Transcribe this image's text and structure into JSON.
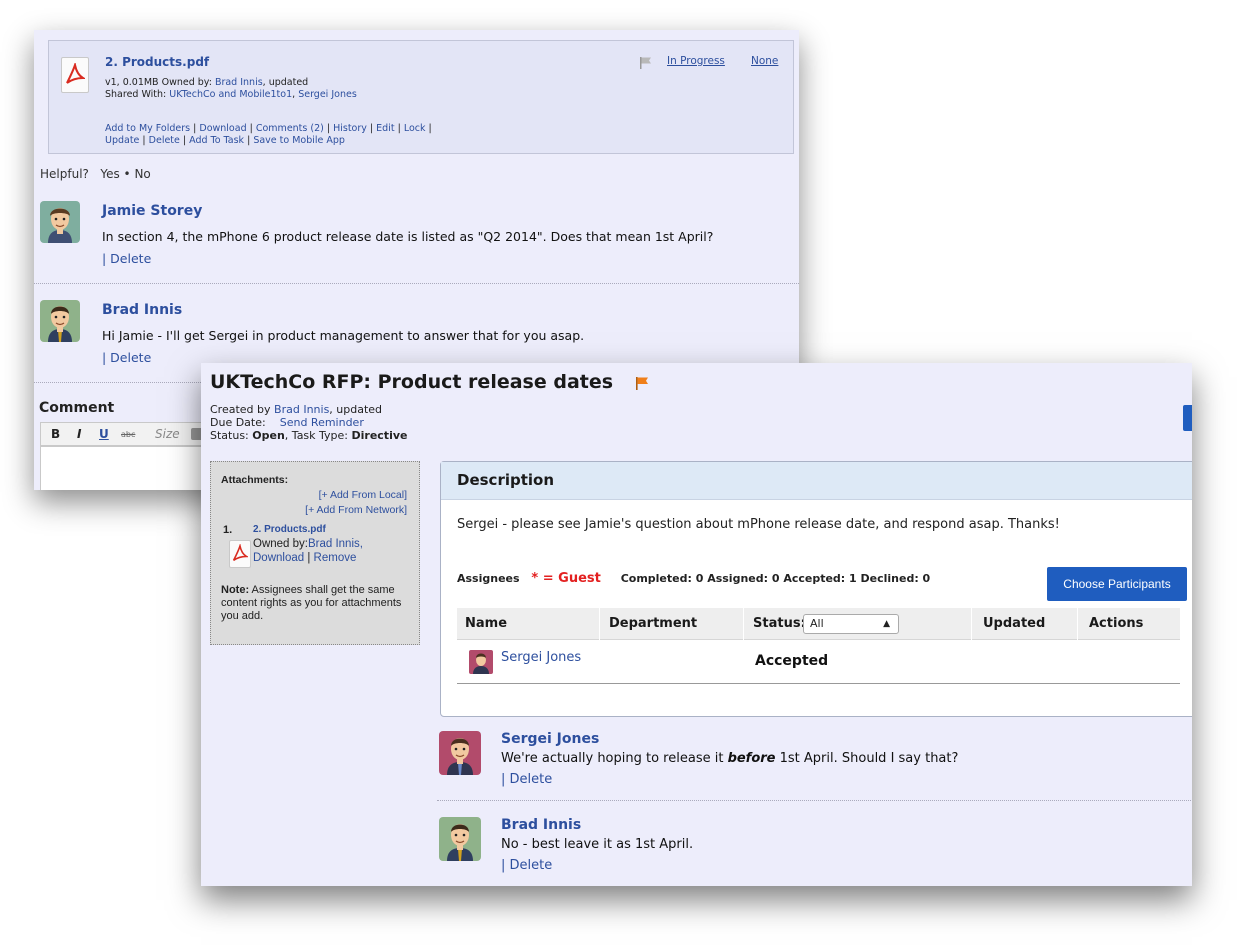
{
  "back_window": {
    "file": {
      "title": "2. Products.pdf",
      "meta_line1_prefix": "v1, 0.01MB Owned by: ",
      "owner": "Brad Innis",
      "meta_line1_suffix": ", updated",
      "shared_prefix": "Shared With: ",
      "shared_group": "UKTechCo and Mobile1to1",
      "shared_user": "Sergei Jones",
      "status": "In Progress",
      "priority": "None",
      "actions_line1": [
        "Add to My Folders",
        "Download",
        "Comments (2)",
        "History",
        "Edit",
        "Lock"
      ],
      "actions_line2": [
        "Update",
        "Delete",
        "Add To Task",
        "Save to Mobile App"
      ]
    },
    "helpful": {
      "label": "Helpful?",
      "yes": "Yes",
      "sep": "•",
      "no": "No"
    },
    "comments": [
      {
        "name": "Jamie Storey",
        "text": "In section 4, the mPhone 6 product release date is listed as \"Q2 2014\". Does that mean 1st April?",
        "delete": "| Delete"
      },
      {
        "name": "Brad Innis",
        "text": "Hi Jamie - I'll get Sergei in product management to answer that for you asap.",
        "delete": "| Delete"
      }
    ],
    "comment_label": "Comment",
    "editor_toolbar": {
      "bold": "B",
      "italic": "I",
      "underline": "U",
      "strike": "abc",
      "size": "Size"
    }
  },
  "front_window": {
    "title": "UKTechCo RFP: Product release dates",
    "created_by_prefix": "Created by ",
    "created_by": "Brad Innis",
    "created_by_suffix": ", updated",
    "due_date_label": "Due Date:",
    "send_reminder": "Send Reminder",
    "status_label": "Status: ",
    "status_value": "Open",
    "task_type_label": ", Task Type: ",
    "task_type_value": "Directive",
    "attachments": {
      "label": "Attachments:",
      "add_local": "[+ Add From Local]",
      "add_network": "[+ Add From Network]",
      "item_number": "1.",
      "item_name": "2. Products.pdf",
      "owned_by_prefix": "Owned by:",
      "owned_by": "Brad Innis,",
      "download": "Download",
      "remove": "Remove",
      "note_label": "Note:",
      "note_text": " Assignees shall get the same content rights as you for attachments you add."
    },
    "description": {
      "title": "Description",
      "text": "Sergei - please see Jamie's question about mPhone release date, and respond asap. Thanks!",
      "assignees_label": "Assignees",
      "guest_legend": "* = Guest",
      "counts": "Completed: 0 Assigned: 0 Accepted: 1 Declined: 0",
      "choose_button": "Choose Participants",
      "columns": [
        "Name",
        "Department",
        "Status:",
        "Updated",
        "Actions"
      ],
      "status_filter": "All",
      "rows": [
        {
          "name": "Sergei Jones",
          "department": "",
          "status": "Accepted",
          "updated": "",
          "actions": ""
        }
      ]
    },
    "thread": [
      {
        "name": "Sergei Jones",
        "text_before": "We're actually hoping to release it ",
        "text_emph": "before",
        "text_after": " 1st April. Should I say that?",
        "delete": "| Delete"
      },
      {
        "name": "Brad Innis",
        "text": "No - best leave it as 1st April.",
        "delete": "| Delete"
      }
    ]
  },
  "colors": {
    "link": "#2d4f9e",
    "window_bg": "#ededfb",
    "button_blue": "#1f5dbf",
    "guest_red": "#e32020",
    "flag_orange": "#f07f1a"
  }
}
